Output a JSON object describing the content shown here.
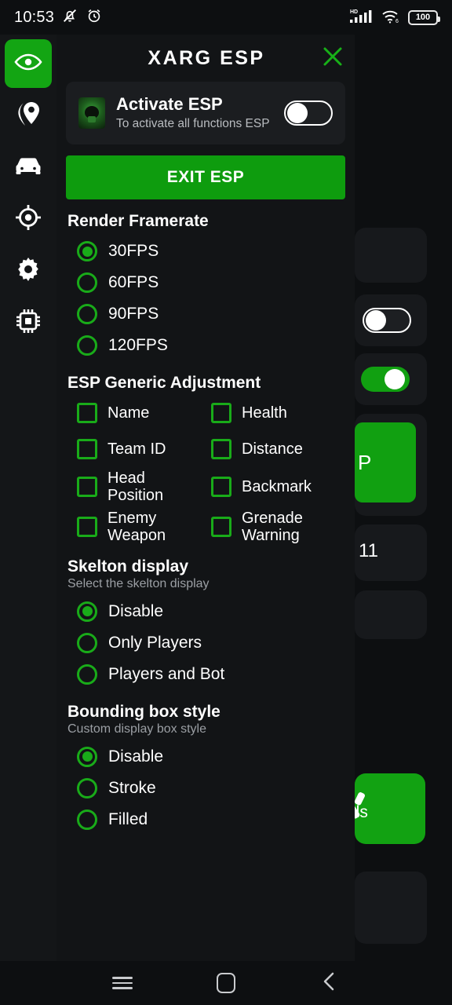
{
  "statusbar": {
    "time": "10:53",
    "icons_left": [
      "mute-bell-icon",
      "alarm-clock-icon"
    ],
    "network_label": "HD",
    "wifi_label": "6",
    "battery_level": "100"
  },
  "sidebar": {
    "items": [
      {
        "name": "sidebar-item-esp",
        "icon": "eye-icon",
        "active": true
      },
      {
        "name": "sidebar-item-location",
        "icon": "location-pin-icon",
        "active": false
      },
      {
        "name": "sidebar-item-vehicle",
        "icon": "car-icon",
        "active": false
      },
      {
        "name": "sidebar-item-aim",
        "icon": "crosshair-icon",
        "active": false
      },
      {
        "name": "sidebar-item-settings",
        "icon": "gear-icon",
        "active": false
      },
      {
        "name": "sidebar-item-memory",
        "icon": "cpu-chip-icon",
        "active": false
      }
    ]
  },
  "panel": {
    "title": "XARG ESP",
    "close_icon": "close-x-icon",
    "activate_card": {
      "title": "Activate ESP",
      "subtitle": "To activate all functions ESP",
      "thumbnail": "game-avatar-thumbnail",
      "toggle_state": "off"
    },
    "exit_button": "EXIT ESP",
    "sections": [
      {
        "name": "render-framerate",
        "title": "Render Framerate",
        "subtitle": "",
        "type": "radio",
        "options": [
          {
            "label": "30FPS",
            "selected": true
          },
          {
            "label": "60FPS",
            "selected": false
          },
          {
            "label": "90FPS",
            "selected": false
          },
          {
            "label": "120FPS",
            "selected": false
          }
        ]
      },
      {
        "name": "esp-generic-adjustment",
        "title": "ESP Generic Adjustment",
        "subtitle": "",
        "type": "checkbox",
        "options": [
          {
            "label": "Name",
            "checked": false
          },
          {
            "label": "Health",
            "checked": false
          },
          {
            "label": "Team ID",
            "checked": false
          },
          {
            "label": "Distance",
            "checked": false
          },
          {
            "label": "Head Position",
            "checked": false
          },
          {
            "label": "Backmark",
            "checked": false
          },
          {
            "label": "Enemy Weapon",
            "checked": false
          },
          {
            "label": "Grenade Warning",
            "checked": false
          }
        ]
      },
      {
        "name": "skelton-display",
        "title": "Skelton display",
        "subtitle": "Select the skelton display",
        "type": "radio",
        "options": [
          {
            "label": "Disable",
            "selected": true
          },
          {
            "label": "Only Players",
            "selected": false
          },
          {
            "label": "Players and Bot",
            "selected": false
          }
        ]
      },
      {
        "name": "bounding-box-style",
        "title": "Bounding box style",
        "subtitle": "Custom display box style",
        "type": "radio",
        "options": [
          {
            "label": "Disable",
            "selected": true
          },
          {
            "label": "Stroke",
            "selected": false
          },
          {
            "label": "Filled",
            "selected": false
          }
        ]
      }
    ]
  },
  "background": {
    "green_button_fragment": "P",
    "number_fragment": "11",
    "tools_card_label": "ols"
  },
  "navbar": {
    "recents": "recents-icon",
    "home": "home-icon",
    "back": "back-icon"
  },
  "colors": {
    "accent_green": "#0e9c0e",
    "bright_green": "#19ab19",
    "panel_bg": "#121416",
    "card_bg": "#1b1d20",
    "screen_bg": "#0d0f11"
  }
}
